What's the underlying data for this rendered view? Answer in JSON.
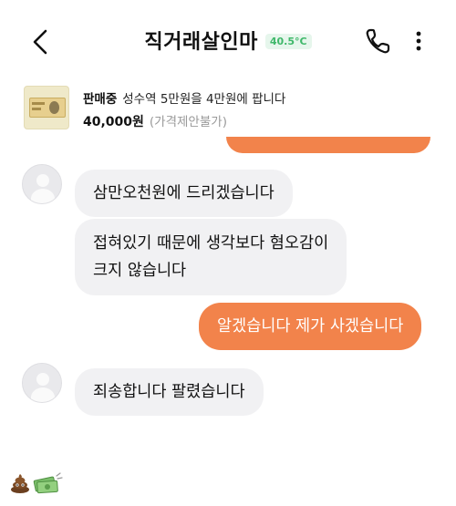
{
  "header": {
    "title": "직거래살인마",
    "temperature": "40.5°C",
    "icons": [
      "back-arrow-icon",
      "phone-icon",
      "more-vertical-icon"
    ]
  },
  "product": {
    "status": "판매중",
    "name": "성수역 5만원을 4만원에 팝니다",
    "price": "40,000원",
    "price_note": "(가격제안불가)"
  },
  "messages": [
    {
      "side": "incoming",
      "text": "삼만오천원에 드리겠습니다"
    },
    {
      "side": "incoming",
      "text": "접혀있기 때문에 생각보다 혐오감이\n크지 않습니다"
    },
    {
      "side": "outgoing",
      "text": "알겠습니다 제가 사겠습니다"
    },
    {
      "side": "incoming",
      "text": "죄송합니다 팔렸습니다"
    }
  ],
  "colors": {
    "accent": "#f2834b",
    "incoming_bubble": "#f1f1f3",
    "temperature": "#3fb86a"
  },
  "footer_emojis": [
    "poop-emoji",
    "money-emoji"
  ]
}
